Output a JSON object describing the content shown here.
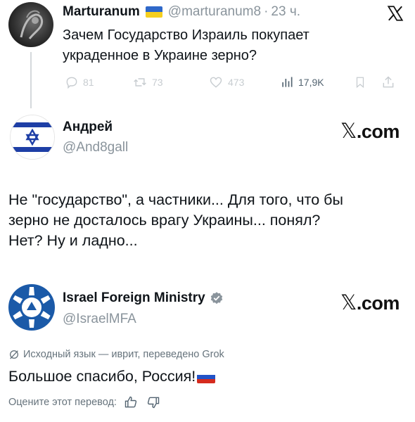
{
  "original_tweet": {
    "author_name": "Marturanum",
    "flag": "ukraine-flag",
    "handle": "@marturanum8",
    "separator": "·",
    "time": "23 ч.",
    "text_line1": "Зачем Государство Израиль покупает",
    "text_line2": "украденное в Украине зерно?",
    "actions": {
      "replies": "81",
      "reposts": "73",
      "likes": "473",
      "views": "17,9K"
    }
  },
  "reply": {
    "author_name": "Андрей",
    "handle": "@And8gall",
    "source": ".com",
    "text_line1": "Не \"государство\", а частники... Для того, что бы",
    "text_line2": "зерно не досталось врагу Украины... понял?",
    "text_line3": "Нет? Ну и ладно..."
  },
  "mfa": {
    "author_name": "Israel Foreign Ministry",
    "handle": "@IsraelMFA",
    "source": ".com",
    "translation_note": "Исходный язык — иврит, переведено Grok",
    "text": "Большое спасибо, Россия!",
    "flag": "russia-flag",
    "rate_label": "Оцените этот перевод:"
  },
  "colors": {
    "text": "#0f1419",
    "muted": "#8a949c",
    "israel_blue": "#1e3fa6",
    "mfa_blue": "#1b5aa8",
    "verified": "#8a949c"
  }
}
